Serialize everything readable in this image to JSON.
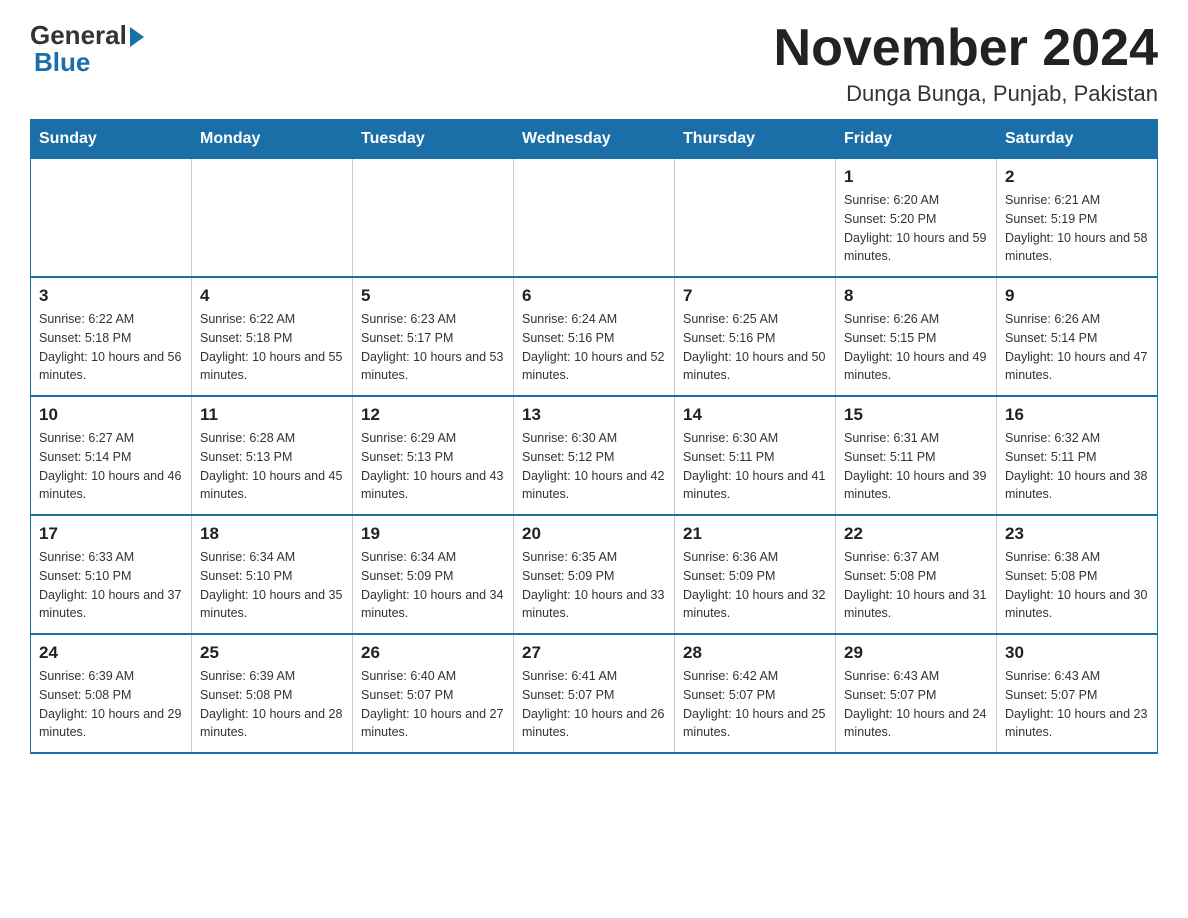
{
  "logo": {
    "general": "General",
    "blue": "Blue"
  },
  "title": "November 2024",
  "subtitle": "Dunga Bunga, Punjab, Pakistan",
  "days_of_week": [
    "Sunday",
    "Monday",
    "Tuesday",
    "Wednesday",
    "Thursday",
    "Friday",
    "Saturday"
  ],
  "weeks": [
    [
      {
        "day": "",
        "info": ""
      },
      {
        "day": "",
        "info": ""
      },
      {
        "day": "",
        "info": ""
      },
      {
        "day": "",
        "info": ""
      },
      {
        "day": "",
        "info": ""
      },
      {
        "day": "1",
        "info": "Sunrise: 6:20 AM\nSunset: 5:20 PM\nDaylight: 10 hours and 59 minutes."
      },
      {
        "day": "2",
        "info": "Sunrise: 6:21 AM\nSunset: 5:19 PM\nDaylight: 10 hours and 58 minutes."
      }
    ],
    [
      {
        "day": "3",
        "info": "Sunrise: 6:22 AM\nSunset: 5:18 PM\nDaylight: 10 hours and 56 minutes."
      },
      {
        "day": "4",
        "info": "Sunrise: 6:22 AM\nSunset: 5:18 PM\nDaylight: 10 hours and 55 minutes."
      },
      {
        "day": "5",
        "info": "Sunrise: 6:23 AM\nSunset: 5:17 PM\nDaylight: 10 hours and 53 minutes."
      },
      {
        "day": "6",
        "info": "Sunrise: 6:24 AM\nSunset: 5:16 PM\nDaylight: 10 hours and 52 minutes."
      },
      {
        "day": "7",
        "info": "Sunrise: 6:25 AM\nSunset: 5:16 PM\nDaylight: 10 hours and 50 minutes."
      },
      {
        "day": "8",
        "info": "Sunrise: 6:26 AM\nSunset: 5:15 PM\nDaylight: 10 hours and 49 minutes."
      },
      {
        "day": "9",
        "info": "Sunrise: 6:26 AM\nSunset: 5:14 PM\nDaylight: 10 hours and 47 minutes."
      }
    ],
    [
      {
        "day": "10",
        "info": "Sunrise: 6:27 AM\nSunset: 5:14 PM\nDaylight: 10 hours and 46 minutes."
      },
      {
        "day": "11",
        "info": "Sunrise: 6:28 AM\nSunset: 5:13 PM\nDaylight: 10 hours and 45 minutes."
      },
      {
        "day": "12",
        "info": "Sunrise: 6:29 AM\nSunset: 5:13 PM\nDaylight: 10 hours and 43 minutes."
      },
      {
        "day": "13",
        "info": "Sunrise: 6:30 AM\nSunset: 5:12 PM\nDaylight: 10 hours and 42 minutes."
      },
      {
        "day": "14",
        "info": "Sunrise: 6:30 AM\nSunset: 5:11 PM\nDaylight: 10 hours and 41 minutes."
      },
      {
        "day": "15",
        "info": "Sunrise: 6:31 AM\nSunset: 5:11 PM\nDaylight: 10 hours and 39 minutes."
      },
      {
        "day": "16",
        "info": "Sunrise: 6:32 AM\nSunset: 5:11 PM\nDaylight: 10 hours and 38 minutes."
      }
    ],
    [
      {
        "day": "17",
        "info": "Sunrise: 6:33 AM\nSunset: 5:10 PM\nDaylight: 10 hours and 37 minutes."
      },
      {
        "day": "18",
        "info": "Sunrise: 6:34 AM\nSunset: 5:10 PM\nDaylight: 10 hours and 35 minutes."
      },
      {
        "day": "19",
        "info": "Sunrise: 6:34 AM\nSunset: 5:09 PM\nDaylight: 10 hours and 34 minutes."
      },
      {
        "day": "20",
        "info": "Sunrise: 6:35 AM\nSunset: 5:09 PM\nDaylight: 10 hours and 33 minutes."
      },
      {
        "day": "21",
        "info": "Sunrise: 6:36 AM\nSunset: 5:09 PM\nDaylight: 10 hours and 32 minutes."
      },
      {
        "day": "22",
        "info": "Sunrise: 6:37 AM\nSunset: 5:08 PM\nDaylight: 10 hours and 31 minutes."
      },
      {
        "day": "23",
        "info": "Sunrise: 6:38 AM\nSunset: 5:08 PM\nDaylight: 10 hours and 30 minutes."
      }
    ],
    [
      {
        "day": "24",
        "info": "Sunrise: 6:39 AM\nSunset: 5:08 PM\nDaylight: 10 hours and 29 minutes."
      },
      {
        "day": "25",
        "info": "Sunrise: 6:39 AM\nSunset: 5:08 PM\nDaylight: 10 hours and 28 minutes."
      },
      {
        "day": "26",
        "info": "Sunrise: 6:40 AM\nSunset: 5:07 PM\nDaylight: 10 hours and 27 minutes."
      },
      {
        "day": "27",
        "info": "Sunrise: 6:41 AM\nSunset: 5:07 PM\nDaylight: 10 hours and 26 minutes."
      },
      {
        "day": "28",
        "info": "Sunrise: 6:42 AM\nSunset: 5:07 PM\nDaylight: 10 hours and 25 minutes."
      },
      {
        "day": "29",
        "info": "Sunrise: 6:43 AM\nSunset: 5:07 PM\nDaylight: 10 hours and 24 minutes."
      },
      {
        "day": "30",
        "info": "Sunrise: 6:43 AM\nSunset: 5:07 PM\nDaylight: 10 hours and 23 minutes."
      }
    ]
  ]
}
